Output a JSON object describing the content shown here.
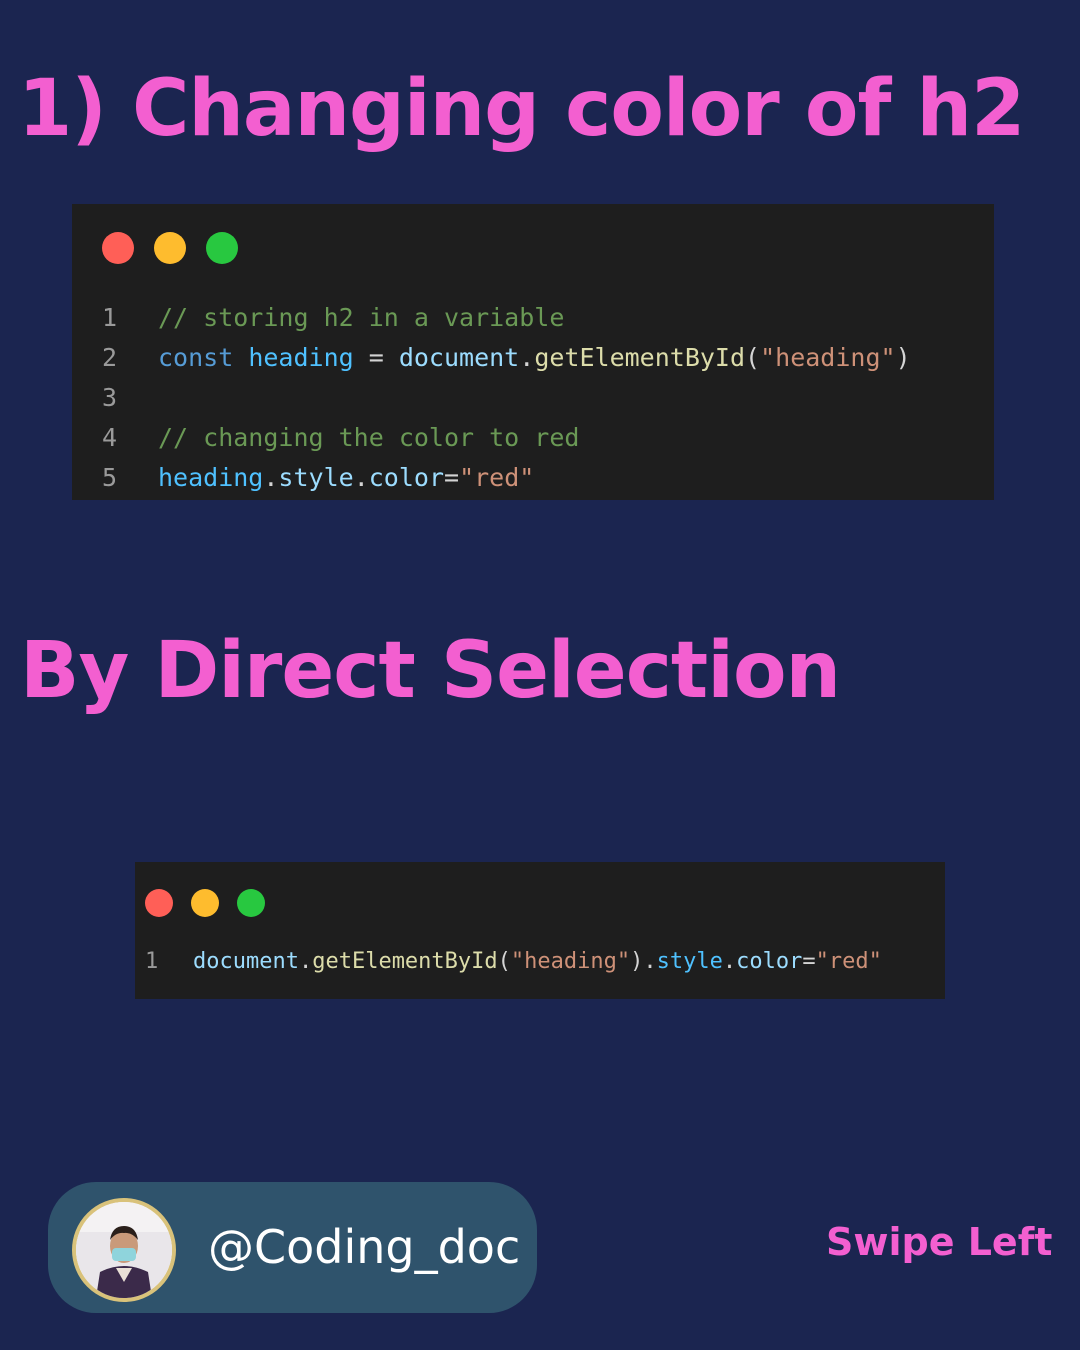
{
  "slide": {
    "title": "1) Changing color of h2",
    "subtitle": "By Direct Selection",
    "swipe": "Swipe Left"
  },
  "colors": {
    "background": "#1b2550",
    "accent": "#f35fd0",
    "code_bg": "#1e1e1e",
    "comment": "#6a9955",
    "keyword": "#569cd6",
    "variable": "#4fc1ff",
    "identifier": "#9cdcfe",
    "function": "#dcdcaa",
    "string": "#ce9178",
    "plain": "#d4d4d4"
  },
  "code_block_1": {
    "lines": [
      {
        "num": "1",
        "tokens": [
          {
            "t": "// storing h2 in a variable",
            "c": "#6a9955"
          }
        ]
      },
      {
        "num": "2",
        "tokens": [
          {
            "t": "const ",
            "c": "#569cd6"
          },
          {
            "t": "heading",
            "c": "#4fc1ff"
          },
          {
            "t": " = ",
            "c": "#d4d4d4"
          },
          {
            "t": "document",
            "c": "#9cdcfe"
          },
          {
            "t": ".",
            "c": "#d4d4d4"
          },
          {
            "t": "getElementById",
            "c": "#dcdcaa"
          },
          {
            "t": "(",
            "c": "#d4d4d4"
          },
          {
            "t": "\"heading\"",
            "c": "#ce9178"
          },
          {
            "t": ")",
            "c": "#d4d4d4"
          }
        ]
      },
      {
        "num": "3",
        "tokens": []
      },
      {
        "num": "4",
        "tokens": [
          {
            "t": "// changing the color to red",
            "c": "#6a9955"
          }
        ]
      },
      {
        "num": "5",
        "tokens": [
          {
            "t": "heading",
            "c": "#4fc1ff"
          },
          {
            "t": ".",
            "c": "#d4d4d4"
          },
          {
            "t": "style",
            "c": "#9cdcfe"
          },
          {
            "t": ".",
            "c": "#d4d4d4"
          },
          {
            "t": "color",
            "c": "#9cdcfe"
          },
          {
            "t": "=",
            "c": "#d4d4d4"
          },
          {
            "t": "\"red\"",
            "c": "#ce9178"
          }
        ]
      }
    ]
  },
  "code_block_2": {
    "lines": [
      {
        "num": "1",
        "tokens": [
          {
            "t": "document",
            "c": "#9cdcfe"
          },
          {
            "t": ".",
            "c": "#d4d4d4"
          },
          {
            "t": "getElementById",
            "c": "#dcdcaa"
          },
          {
            "t": "(",
            "c": "#d4d4d4"
          },
          {
            "t": "\"heading\"",
            "c": "#ce9178"
          },
          {
            "t": ").",
            "c": "#d4d4d4"
          },
          {
            "t": "style",
            "c": "#4fc1ff"
          },
          {
            "t": ".",
            "c": "#d4d4d4"
          },
          {
            "t": "color",
            "c": "#9cdcfe"
          },
          {
            "t": "=",
            "c": "#d4d4d4"
          },
          {
            "t": "\"red\"",
            "c": "#ce9178"
          }
        ]
      }
    ]
  },
  "profile": {
    "handle": "@Coding_doc",
    "avatar_icon": "profile-photo-icon"
  }
}
